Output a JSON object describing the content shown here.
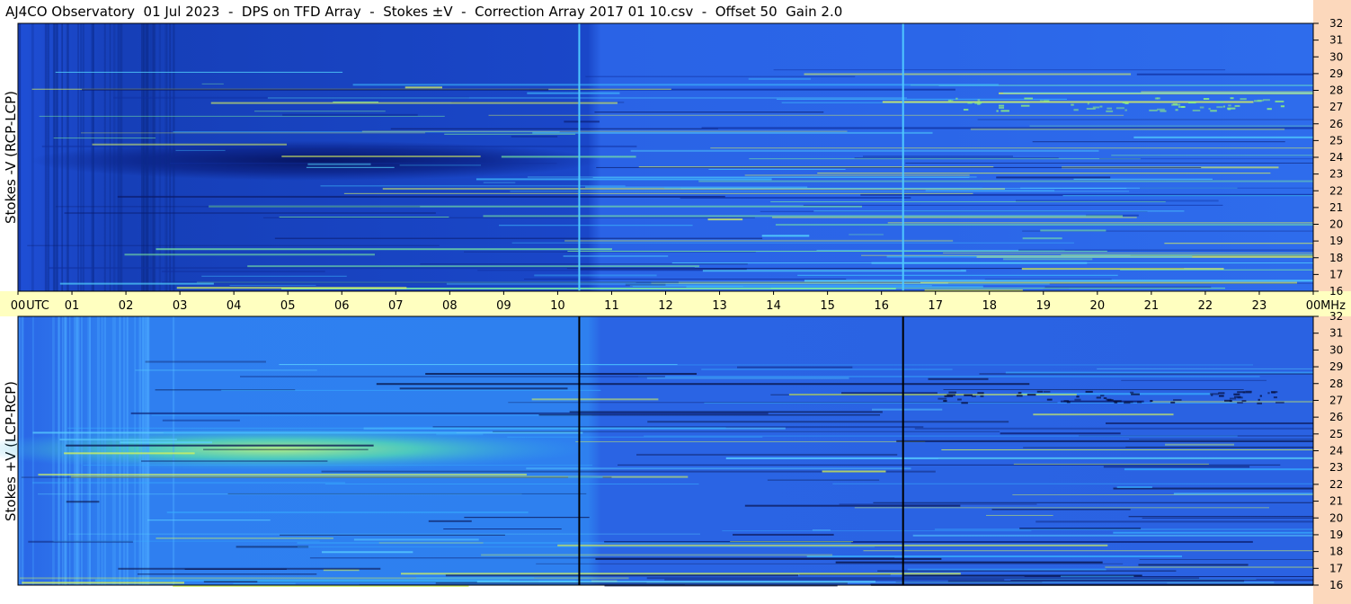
{
  "title": "AJ4CO Observatory  01 Jul 2023  -  DPS on TFD Array  -  Stokes ±V  -  Correction Array 2017 01 10.csv  -  Offset 50  Gain 2.0",
  "panels": [
    {
      "ylabel": "Stokes -V (RCP-LCP)"
    },
    {
      "ylabel": "Stokes +V (LCP-RCP)"
    }
  ],
  "colors": {
    "time_bar": "#ffffc0",
    "freq_strip": "#fcd8bc",
    "plot_base": "#2157e2"
  },
  "chart_data": {
    "type": "heatmap",
    "title": "AJ4CO Observatory  01 Jul 2023  -  DPS on TFD Array  -  Stokes ±V  -  Correction Array 2017 01 10.csv  -  Offset 50  Gain 2.0",
    "x_tick_labels": [
      "00",
      "UTC",
      "01",
      "02",
      "03",
      "04",
      "05",
      "06",
      "07",
      "08",
      "09",
      "10",
      "11",
      "12",
      "13",
      "14",
      "15",
      "16",
      "17",
      "18",
      "19",
      "20",
      "21",
      "22",
      "23",
      "00",
      "MHz"
    ],
    "x_ticks_hours": [
      0,
      1,
      2,
      3,
      4,
      5,
      6,
      7,
      8,
      9,
      10,
      11,
      12,
      13,
      14,
      15,
      16,
      17,
      18,
      19,
      20,
      21,
      22,
      23,
      24
    ],
    "xlim_utc_hours": [
      0,
      24
    ],
    "y_ticks_mhz": [
      16,
      17,
      18,
      19,
      20,
      21,
      22,
      23,
      24,
      25,
      26,
      27,
      28,
      29,
      30,
      31,
      32
    ],
    "ylim_mhz": [
      16,
      32
    ],
    "vertical_lines_utc_hours": [
      10.4,
      16.4
    ],
    "series": [
      {
        "name": "Stokes -V (RCP-LCP)"
      },
      {
        "name": "Stokes +V (LCP-RCP)"
      }
    ],
    "grid": false
  }
}
